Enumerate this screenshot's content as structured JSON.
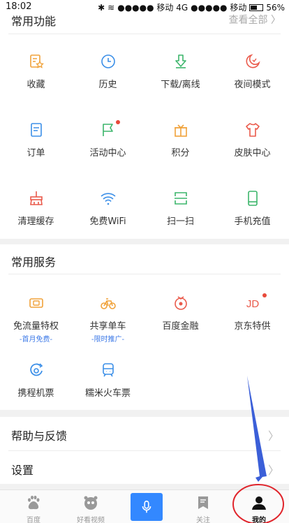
{
  "status_bar": {
    "time": "18:02",
    "carrier1": "●●●●● 移动 4G",
    "carrier2": "●●●●● 移动",
    "battery_percent": "56%",
    "battery_level": 0.56
  },
  "common_functions": {
    "title": "常用功能",
    "more": "查看全部",
    "items": [
      {
        "label": "收藏",
        "icon": "favorite-icon",
        "color": "#f0a23a"
      },
      {
        "label": "历史",
        "icon": "history-clock-icon",
        "color": "#3b8fe8"
      },
      {
        "label": "下载/离线",
        "icon": "download-icon",
        "color": "#3cb56b"
      },
      {
        "label": "夜间模式",
        "icon": "night-mode-icon",
        "color": "#ea5a4b"
      },
      {
        "label": "订单",
        "icon": "order-icon",
        "color": "#3b8fe8"
      },
      {
        "label": "活动中心",
        "icon": "flag-icon",
        "color": "#3cb56b"
      },
      {
        "label": "积分",
        "icon": "gift-icon",
        "color": "#f0a23a"
      },
      {
        "label": "皮肤中心",
        "icon": "shirt-icon",
        "color": "#ea5a4b"
      },
      {
        "label": "清理缓存",
        "icon": "broom-icon",
        "color": "#ea5a4b"
      },
      {
        "label": "免费WiFi",
        "icon": "wifi-icon",
        "color": "#3b8fe8"
      },
      {
        "label": "扫一扫",
        "icon": "scan-icon",
        "color": "#3cb56b"
      },
      {
        "label": "手机充值",
        "icon": "phone-icon",
        "color": "#3cb56b"
      }
    ]
  },
  "common_services": {
    "title": "常用服务",
    "items": [
      {
        "label": "免流量特权",
        "sub": "-首月免费-",
        "icon": "data-privilege-icon",
        "color": "#f0a23a"
      },
      {
        "label": "共享单车",
        "sub": "-限时推广-",
        "icon": "bicycle-icon",
        "color": "#f0a23a"
      },
      {
        "label": "百度金融",
        "sub": "",
        "icon": "finance-icon",
        "color": "#ea5a4b"
      },
      {
        "label": "京东特供",
        "sub": "",
        "icon": "jd-icon",
        "color": "#ea5a4b"
      },
      {
        "label": "携程机票",
        "sub": "",
        "icon": "ctrip-icon",
        "color": "#3b8fe8"
      },
      {
        "label": "糯米火车票",
        "sub": "",
        "icon": "train-icon",
        "color": "#3b8fe8"
      }
    ]
  },
  "settings_rows": {
    "help_feedback": "帮助与反馈",
    "settings": "设置"
  },
  "tab_bar": {
    "items": [
      "百度",
      "好看视频",
      "关注",
      "我的"
    ],
    "active": "我的"
  },
  "colors": {
    "accent_blue": "#3388ff",
    "annotation_red": "#e0242b",
    "annotation_arrow": "#3b5fd8"
  }
}
